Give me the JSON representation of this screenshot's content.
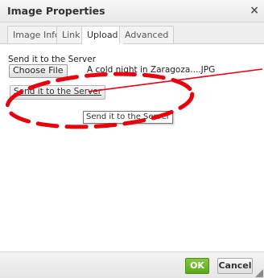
{
  "dialog": {
    "title": "Image Properties",
    "close_glyph": "×"
  },
  "tabs": [
    {
      "label": "Image Info",
      "active": false
    },
    {
      "label": "Link",
      "active": false
    },
    {
      "label": "Upload",
      "active": true
    },
    {
      "label": "Advanced",
      "active": false
    }
  ],
  "upload": {
    "send_label": "Send it to the Server",
    "choose_file_label": "Choose File",
    "selected_file": "A cold night in Zaragoza....JPG",
    "send_button_label": "Send it to the Server",
    "tooltip": "Send it to the Server"
  },
  "footer": {
    "ok_label": "OK",
    "cancel_label": "Cancel"
  },
  "colors": {
    "ok_green": "#6eb52d",
    "annotation_red": "#e8000d"
  },
  "icons": {
    "close": "close-icon",
    "resize": "resize-grip-icon"
  }
}
